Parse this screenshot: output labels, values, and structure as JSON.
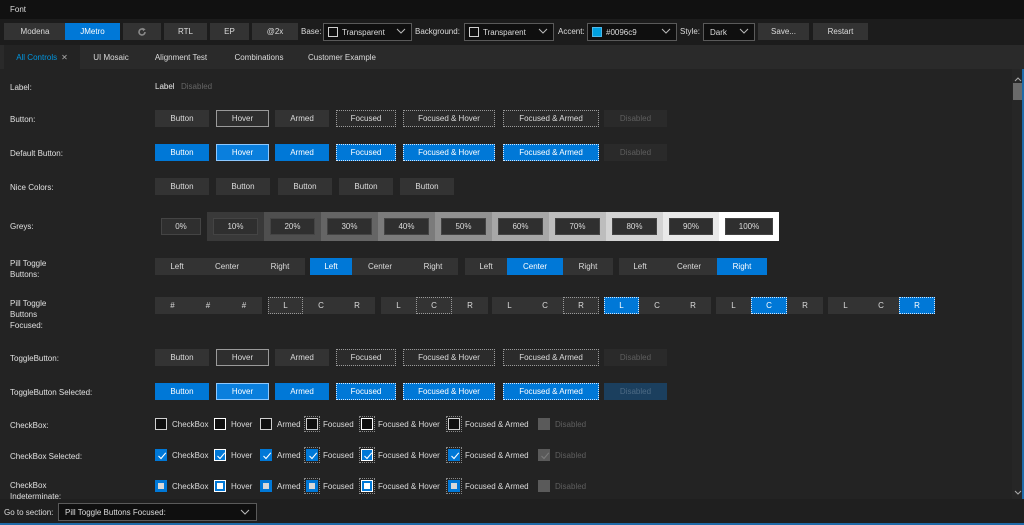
{
  "titlebar": {
    "title": "Font"
  },
  "toolbar": {
    "theme_buttons": [
      {
        "label": "Modena",
        "selected": false
      },
      {
        "label": "JMetro",
        "selected": true
      }
    ],
    "refresh_icon": "refresh-icon",
    "rtl_label": "RTL",
    "ep_label": "EP",
    "scale_label": "@2x",
    "base_label": "Base:",
    "base_value": "Transparent",
    "background_label": "Background:",
    "background_value": "Transparent",
    "accent_label": "Accent:",
    "accent_value": "#0096c9",
    "accent_color": "#0096c9",
    "style_label": "Style:",
    "style_value": "Dark",
    "save_label": "Save...",
    "restart_label": "Restart"
  },
  "tabs": [
    {
      "label": "All Controls",
      "active": true,
      "closable": true
    },
    {
      "label": "UI Mosaic",
      "active": false
    },
    {
      "label": "Alignment Test",
      "active": false
    },
    {
      "label": "Combinations",
      "active": false
    },
    {
      "label": "Customer Example",
      "active": false
    }
  ],
  "rows": {
    "label": {
      "title": "Label:",
      "items": [
        "Label",
        "Disabled"
      ]
    },
    "button": {
      "title": "Button:",
      "items": [
        "Button",
        "Hover",
        "Armed",
        "Focused",
        "Focused & Hover",
        "Focused & Armed",
        "Disabled"
      ]
    },
    "default_button": {
      "title": "Default Button:",
      "items": [
        "Button",
        "Hover",
        "Armed",
        "Focused",
        "Focused & Hover",
        "Focused & Armed",
        "Disabled"
      ]
    },
    "nice_colors": {
      "title": "Nice Colors:",
      "items": [
        "Button",
        "Button",
        "Button",
        "Button",
        "Button"
      ]
    },
    "greys": {
      "title": "Greys:",
      "items": [
        "0%",
        "10%",
        "20%",
        "30%",
        "40%",
        "50%",
        "60%",
        "70%",
        "80%",
        "90%",
        "100%"
      ]
    },
    "pill_toggle": {
      "title_line1": "Pill Toggle",
      "title_line2": "Buttons:",
      "groups": [
        {
          "items": [
            "Left",
            "Center",
            "Right"
          ],
          "selected": null
        },
        {
          "items": [
            "Left",
            "Center",
            "Right"
          ],
          "selected": 0
        },
        {
          "items": [
            "Left",
            "Center",
            "Right"
          ],
          "selected": 1
        },
        {
          "items": [
            "Left",
            "Center",
            "Right"
          ],
          "selected": 2
        }
      ]
    },
    "pill_toggle_focused": {
      "title_line1": "Pill Toggle",
      "title_line2": "Buttons",
      "title_line3": "Focused:",
      "groups": [
        {
          "items": [
            "#",
            "#",
            "#"
          ],
          "selected": null,
          "focused": null
        },
        {
          "items": [
            "L",
            "C",
            "R"
          ],
          "selected": null,
          "focused": 0
        },
        {
          "items": [
            "L",
            "C",
            "R"
          ],
          "selected": null,
          "focused": 1
        },
        {
          "items": [
            "L",
            "C",
            "R"
          ],
          "selected": null,
          "focused": 2
        },
        {
          "items": [
            "L",
            "C",
            "R"
          ],
          "selected": 0,
          "focused": 0
        },
        {
          "items": [
            "L",
            "C",
            "R"
          ],
          "selected": 1,
          "focused": 1
        },
        {
          "items": [
            "L",
            "C",
            "R"
          ],
          "selected": 2,
          "focused": 2
        }
      ]
    },
    "toggle_button": {
      "title": "ToggleButton:",
      "items": [
        "Button",
        "Hover",
        "Armed",
        "Focused",
        "Focused & Hover",
        "Focused & Armed",
        "Disabled"
      ]
    },
    "toggle_button_selected": {
      "title": "ToggleButton Selected:",
      "items": [
        "Button",
        "Hover",
        "Armed",
        "Focused",
        "Focused & Hover",
        "Focused & Armed",
        "Disabled"
      ]
    },
    "checkbox": {
      "title": "CheckBox:",
      "items": [
        "CheckBox",
        "Hover",
        "Armed",
        "Focused",
        "Focused & Hover",
        "Focused & Armed",
        "Disabled"
      ]
    },
    "checkbox_selected": {
      "title": "CheckBox Selected:",
      "items": [
        "CheckBox",
        "Hover",
        "Armed",
        "Focused",
        "Focused & Hover",
        "Focused & Armed",
        "Disabled"
      ]
    },
    "checkbox_indeterminate": {
      "title_line1": "CheckBox",
      "title_line2": "Indeterminate:",
      "items": [
        "CheckBox",
        "Hover",
        "Armed",
        "Focused",
        "Focused & Hover",
        "Focused & Armed",
        "Disabled"
      ]
    }
  },
  "bottom": {
    "goto_label": "Go to section:",
    "goto_value": "Pill Toggle Buttons Focused:"
  },
  "colors": {
    "accent_blue": "#0078d7",
    "tab_active_text": "#0096e0",
    "background": "#232323"
  }
}
